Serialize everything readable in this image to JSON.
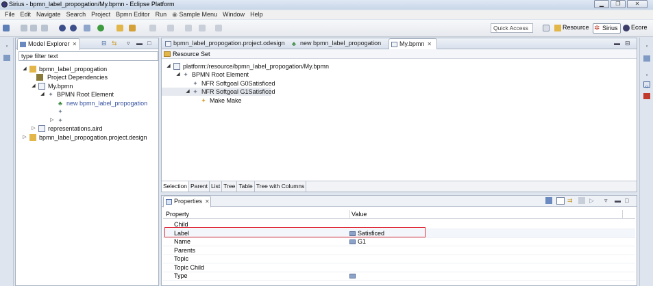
{
  "window": {
    "title": "Sirius - bpmn_label_propogation/My.bpmn - Eclipse Platform",
    "controls": [
      "▁",
      "❐",
      "✕"
    ]
  },
  "menubar": {
    "items": [
      "File",
      "Edit",
      "Navigate",
      "Search",
      "Project",
      "Bpmn Editor",
      "Run",
      "Sample Menu",
      "Window",
      "Help"
    ]
  },
  "toolbar": {
    "quick_access": "Quick Access",
    "perspectives": [
      "Resource",
      "Sirius",
      "Ecore"
    ]
  },
  "model_explorer": {
    "tab_label": "Model Explorer",
    "filter_value": "type filter text",
    "tree": [
      {
        "label": "bpmn_label_propogation"
      },
      {
        "label": "Project Dependencies"
      },
      {
        "label": "My.bpmn"
      },
      {
        "label": "BPMN Root Element"
      },
      {
        "label": "new bpmn_label_propogation"
      },
      {
        "label": ""
      },
      {
        "label": ""
      },
      {
        "label": "representations.aird"
      },
      {
        "label": "bpmn_label_propogation.project.design"
      }
    ]
  },
  "editor": {
    "tabs": [
      "bpmn_label_propogation.project.odesign",
      "new bpmn_label_propogation",
      "My.bpmn"
    ],
    "resource_set": "Resource Set",
    "tree": [
      {
        "label": "platform:/resource/bpmn_label_propogation/My.bpmn"
      },
      {
        "label": "BPMN Root Element"
      },
      {
        "label": "NFR Softgoal G0Satisficed"
      },
      {
        "label": "NFR Softgoal G1Satisficed"
      },
      {
        "label": "Make Make"
      }
    ],
    "subtabs": [
      "Selection",
      "Parent",
      "List",
      "Tree",
      "Table",
      "Tree with Columns"
    ]
  },
  "properties": {
    "tab_label": "Properties",
    "header": {
      "property": "Property",
      "value": "Value"
    },
    "rows": [
      {
        "property": "Child",
        "value": ""
      },
      {
        "property": "Label",
        "value": "Satisficed"
      },
      {
        "property": "Name",
        "value": "G1"
      },
      {
        "property": "Parents",
        "value": ""
      },
      {
        "property": "Topic",
        "value": ""
      },
      {
        "property": "Topic Child",
        "value": ""
      },
      {
        "property": "Type",
        "value": ""
      }
    ]
  }
}
